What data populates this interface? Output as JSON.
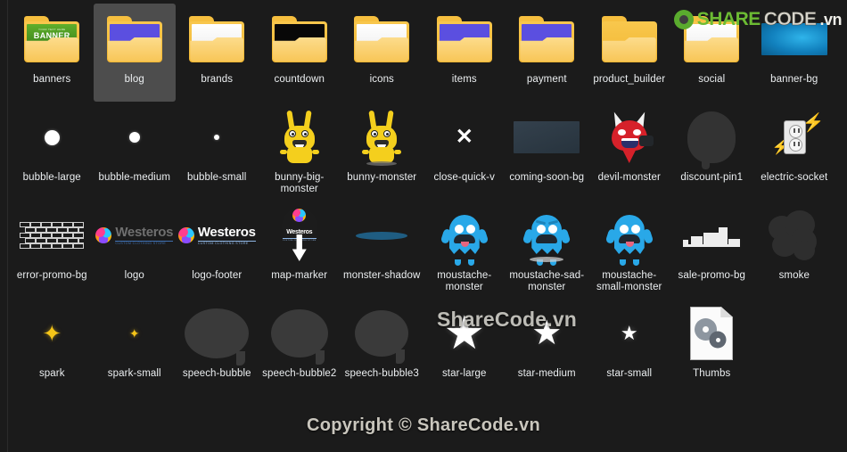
{
  "window": {
    "background_color": "#1b1b1b",
    "selected_item": "blog"
  },
  "watermarks": {
    "top_right": {
      "share": "SHARE",
      "code": "CODE",
      "vn": ".vn",
      "icon": "recycle-icon"
    },
    "middle": "ShareCode.vn",
    "bottom": "Copyright © ShareCode.vn"
  },
  "items": [
    {
      "label": "banners",
      "kind": "folder",
      "art": "banner",
      "banner_small": "YOUR TEXT HERE",
      "banner_big": "BANNER",
      "selected": false
    },
    {
      "label": "blog",
      "kind": "folder",
      "art": "blue",
      "selected": true
    },
    {
      "label": "brands",
      "kind": "folder",
      "art": "white",
      "selected": false
    },
    {
      "label": "countdown",
      "kind": "folder",
      "art": "black",
      "selected": false
    },
    {
      "label": "icons",
      "kind": "folder",
      "art": "white",
      "selected": false
    },
    {
      "label": "items",
      "kind": "folder",
      "art": "blue",
      "selected": false
    },
    {
      "label": "payment",
      "kind": "folder",
      "art": "blue",
      "selected": false
    },
    {
      "label": "product_builder",
      "kind": "folder",
      "art": "none",
      "selected": false
    },
    {
      "label": "social",
      "kind": "folder",
      "art": "white",
      "selected": false
    },
    {
      "label": "banner-bg",
      "kind": "swatch",
      "color": "#1592d0",
      "selected": false
    },
    {
      "label": "bubble-large",
      "kind": "dot",
      "size": 17,
      "selected": false
    },
    {
      "label": "bubble-medium",
      "kind": "dot",
      "size": 12,
      "selected": false
    },
    {
      "label": "bubble-small",
      "kind": "dot",
      "size": 6,
      "selected": false
    },
    {
      "label": "bunny-big-monster",
      "kind": "bunny",
      "shadow": false,
      "selected": false
    },
    {
      "label": "bunny-monster",
      "kind": "bunny",
      "shadow": true,
      "selected": false
    },
    {
      "label": "close-quick-v",
      "kind": "close",
      "glyph": "✕",
      "selected": false
    },
    {
      "label": "coming-soon-bg",
      "kind": "swatch",
      "color": "#2d3b46",
      "selected": false
    },
    {
      "label": "devil-monster",
      "kind": "devil",
      "selected": false
    },
    {
      "label": "discount-pin1",
      "kind": "pin",
      "selected": false
    },
    {
      "label": "electric-socket",
      "kind": "socket",
      "selected": false
    },
    {
      "label": "error-promo-bg",
      "kind": "bricks",
      "selected": false
    },
    {
      "label": "logo",
      "kind": "logo",
      "brand": "Westeros",
      "tagline": "CUSTOM CLOTHING STORE",
      "variant": "dim",
      "selected": false
    },
    {
      "label": "logo-footer",
      "kind": "logo",
      "brand": "Westeros",
      "tagline": "CUSTOM CLOTHING STORE",
      "variant": "bright",
      "selected": false
    },
    {
      "label": "map-marker",
      "kind": "marker",
      "brand": "Westeros",
      "tagline": "CUSTOM CLOTHING STORE",
      "selected": false
    },
    {
      "label": "monster-shadow",
      "kind": "mshadow",
      "selected": false
    },
    {
      "label": "moustache-monster",
      "kind": "monster",
      "mood": "happy",
      "shadow": false,
      "selected": false
    },
    {
      "label": "moustache-sad-monster",
      "kind": "monster",
      "mood": "sad",
      "shadow": true,
      "selected": false
    },
    {
      "label": "moustache-small-monster",
      "kind": "monster",
      "mood": "happy",
      "shadow": false,
      "selected": false
    },
    {
      "label": "sale-promo-bg",
      "kind": "skyline",
      "selected": false
    },
    {
      "label": "smoke",
      "kind": "smoke",
      "selected": false
    },
    {
      "label": "spark",
      "kind": "spark",
      "size": 26,
      "glyph": "✦",
      "selected": false
    },
    {
      "label": "spark-small",
      "kind": "spark",
      "size": 14,
      "glyph": "✦",
      "selected": false
    },
    {
      "label": "speech-bubble",
      "kind": "bubble",
      "w": 72,
      "h": 56,
      "selected": false
    },
    {
      "label": "speech-bubble2",
      "kind": "bubble",
      "w": 64,
      "h": 54,
      "selected": false
    },
    {
      "label": "speech-bubble3",
      "kind": "bubble",
      "w": 60,
      "h": 52,
      "selected": false
    },
    {
      "label": "star-large",
      "kind": "star",
      "size": 52,
      "glyph": "★",
      "selected": false
    },
    {
      "label": "star-medium",
      "kind": "star",
      "size": 38,
      "glyph": "★",
      "selected": false
    },
    {
      "label": "star-small",
      "kind": "star",
      "size": 22,
      "glyph": "★",
      "selected": false
    },
    {
      "label": "Thumbs",
      "kind": "doc",
      "selected": false
    }
  ]
}
